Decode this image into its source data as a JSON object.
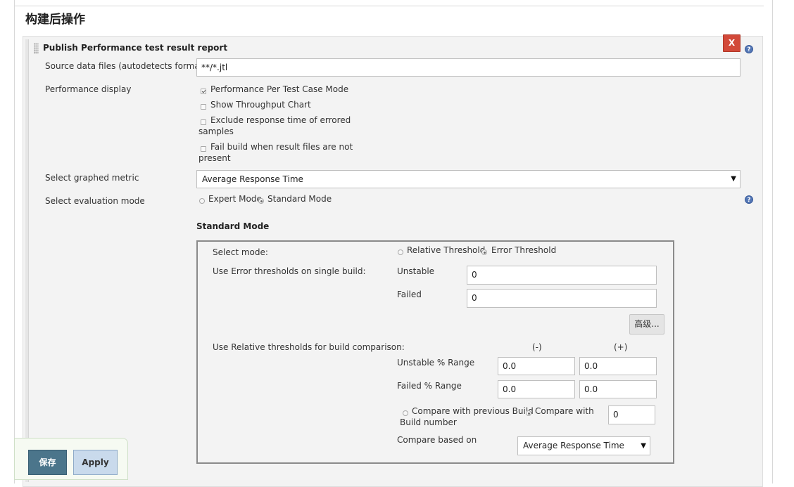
{
  "section": {
    "title": "构建后操作"
  },
  "builder": {
    "title": "Publish Performance test result report",
    "delete_label": "X",
    "help_glyph": "?"
  },
  "source": {
    "label": "Source data files (autodetects format):",
    "value": "**/*.jtl"
  },
  "display": {
    "label": "Performance display",
    "options": [
      {
        "line1": "Performance Per Test Case Mode",
        "line2": "",
        "checked": true
      },
      {
        "line1": "Show Throughput Chart",
        "line2": "",
        "checked": false
      },
      {
        "line1": "Exclude response time of errored",
        "line2": "samples",
        "checked": false
      },
      {
        "line1": "Fail build when result files are not",
        "line2": "present",
        "checked": false
      }
    ]
  },
  "metric": {
    "label": "Select graphed metric",
    "selected": "Average Response Time"
  },
  "evaluation": {
    "label": "Select evaluation mode",
    "options": [
      {
        "label": "Expert Mode",
        "selected": false
      },
      {
        "label": "Standard Mode",
        "selected": true
      }
    ]
  },
  "standard": {
    "heading": "Standard Mode",
    "select_mode_label": "Select mode:",
    "modes": [
      {
        "label": "Relative Threshold",
        "selected": false
      },
      {
        "label": "Error Threshold",
        "selected": true
      }
    ],
    "error_label": "Use Error thresholds on single build:",
    "unstable_label": "Unstable",
    "unstable_value": "0",
    "failed_label": "Failed",
    "failed_value": "0",
    "advanced_label": "高级...",
    "relative_label": "Use Relative thresholds for build comparison:",
    "minus_header": "(-)",
    "plus_header": "(+)",
    "unstable_range_label": "Unstable % Range",
    "unstable_range_minus": "0.0",
    "unstable_range_plus": "0.0",
    "failed_range_label": "Failed % Range",
    "failed_range_minus": "0.0",
    "failed_range_plus": "0.0",
    "compare_previous_label": "Compare with previous Build",
    "compare_with_label": "Compare with",
    "build_number_label": "Build number",
    "compare_previous_selected": false,
    "compare_number_selected": true,
    "build_number_value": "0",
    "based_on_label": "Compare based on",
    "based_on_selected": "Average Response Time"
  },
  "footer": {
    "save_label": "保存",
    "apply_label": "Apply"
  },
  "colors": {
    "delete": "#d24939",
    "save": "#4b758b",
    "apply": "#c9daec",
    "help": "#5477b5"
  }
}
